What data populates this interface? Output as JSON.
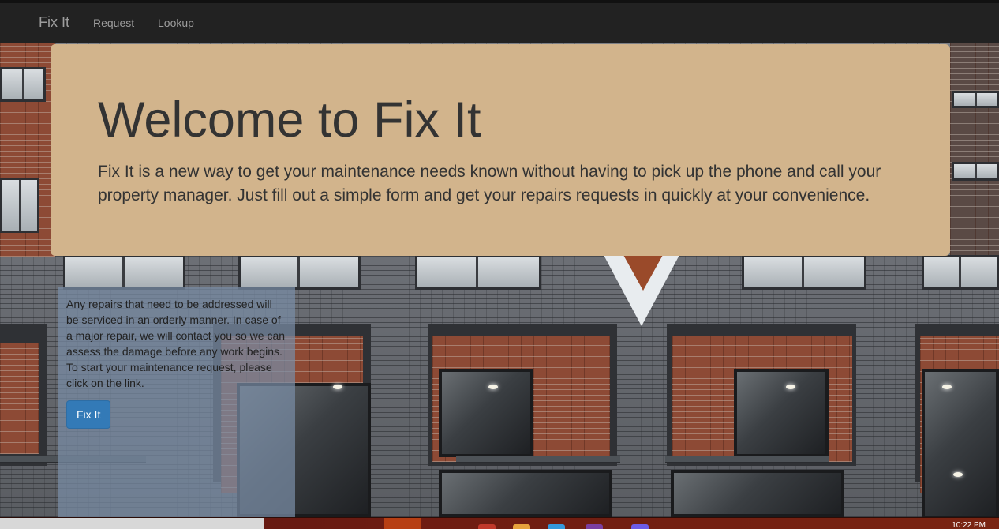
{
  "navbar": {
    "brand": "Fix It",
    "links": [
      "Request",
      "Lookup"
    ]
  },
  "jumbotron": {
    "title": "Welcome to Fix It",
    "text": "Fix It is a new way to get your maintenance needs known without having to pick up the phone and call your property manager. Just fill out a simple form and get your repairs requests in quickly at your convenience."
  },
  "panel": {
    "text": "Any repairs that need to be addressed will be serviced in an orderly manner. In case of a major repair, we will contact you so we can assess the damage before any work begins. To start your maintenance request, please click on the link.",
    "button_label": "Fix It"
  },
  "taskbar": {
    "clock": "10:22 PM"
  },
  "colors": {
    "navbar_bg": "#222222",
    "jumbotron_bg": "#d2b48c",
    "button_primary": "#337ab7",
    "panel_bg": "#788ca5"
  },
  "background": {
    "icon": "building-facade-photo"
  }
}
